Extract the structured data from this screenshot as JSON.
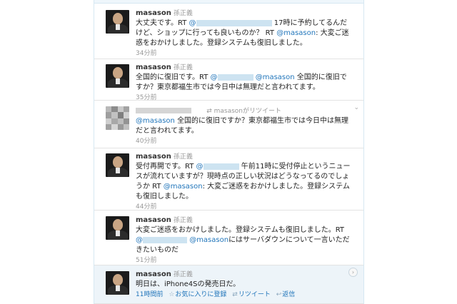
{
  "user": {
    "screen_name": "masason",
    "full_name": "孫正義"
  },
  "tweets": [
    {
      "text_a": "大丈夫です。RT",
      "text_b": "17時に予約してるんだけど、ショップに行っても良いものか？ RT",
      "mention": "@masason",
      "text_c": ": 大変ご迷惑をおかけしました。登録システムも復旧しました。",
      "time": "34分前"
    },
    {
      "text_a": "全国的に復旧です。RT",
      "mention": "@masason",
      "text_b": "全国的に復旧ですか？東京都福生市では今日中は無理だと言われてます。",
      "time": "35分前"
    },
    {
      "retweet_label": "masasonがリツイート",
      "mention": "@masason",
      "text_a": "全国的に復旧ですか？東京都福生市では今日中は無理だと言われてます。",
      "time": "40分前"
    },
    {
      "text_a": "受付再開です。RT",
      "text_b": "午前11時に受付停止というニュースが流れていますが？現時点の正しい状況はどうなってるのでしょうか RT",
      "mention": "@masason",
      "text_c": ": 大変ご迷惑をおかけしました。登録システムも復旧しました。",
      "time": "44分前"
    },
    {
      "text_a": "大変ご迷惑をおかけしました。登録システムも復旧しました。RT",
      "mention": "@masason",
      "text_b": "にはサーバダウンについて一言いただきたいものだ",
      "time": "51分前"
    },
    {
      "text_a": "明日は、iPhone4Sの発売日だ。",
      "time": "11時間前",
      "favorite_label": "お気に入りに登録",
      "retweet_label": "リツイート",
      "reply_label": "返信"
    }
  ]
}
